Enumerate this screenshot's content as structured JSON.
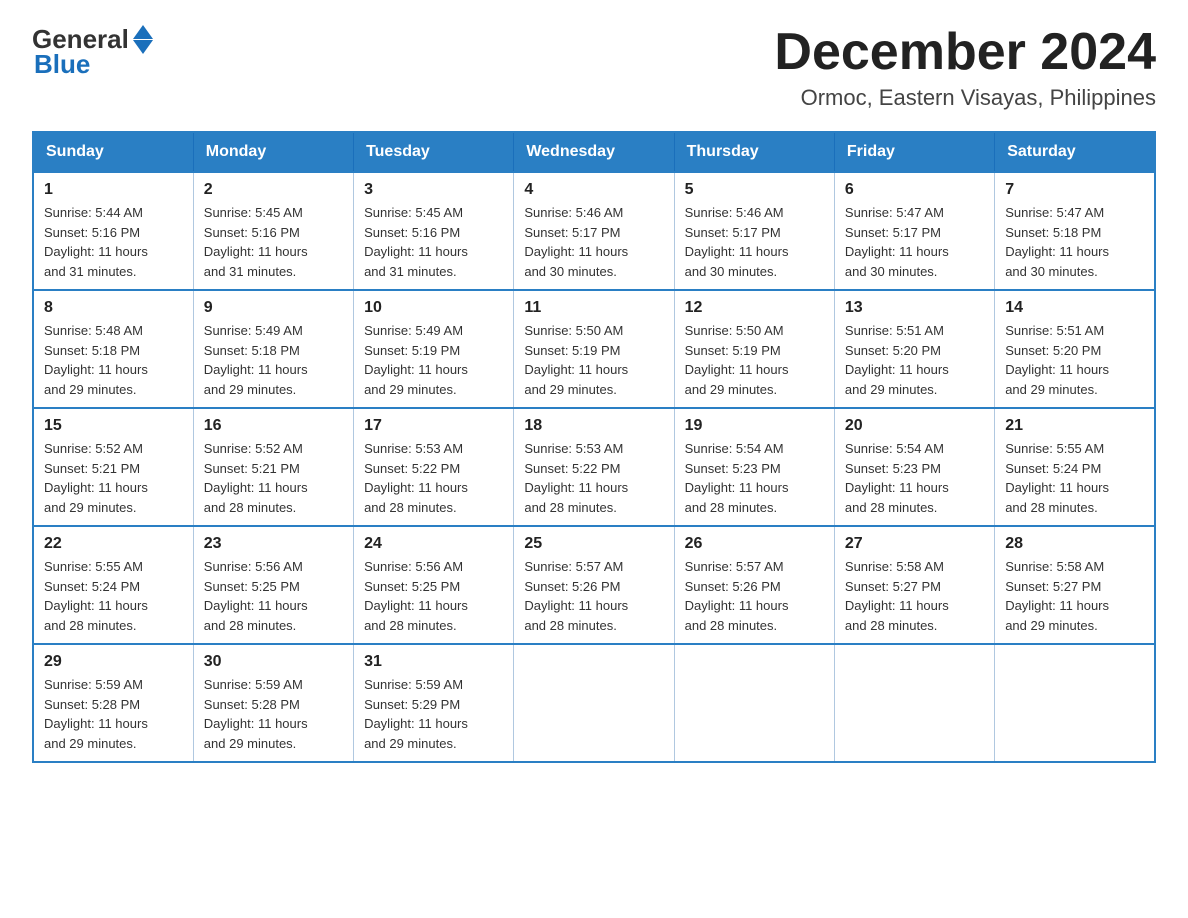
{
  "header": {
    "logo_general": "General",
    "logo_blue": "Blue",
    "month_title": "December 2024",
    "location": "Ormoc, Eastern Visayas, Philippines"
  },
  "weekdays": [
    "Sunday",
    "Monday",
    "Tuesday",
    "Wednesday",
    "Thursday",
    "Friday",
    "Saturday"
  ],
  "weeks": [
    [
      {
        "day": "1",
        "sunrise": "5:44 AM",
        "sunset": "5:16 PM",
        "daylight": "11 hours and 31 minutes."
      },
      {
        "day": "2",
        "sunrise": "5:45 AM",
        "sunset": "5:16 PM",
        "daylight": "11 hours and 31 minutes."
      },
      {
        "day": "3",
        "sunrise": "5:45 AM",
        "sunset": "5:16 PM",
        "daylight": "11 hours and 31 minutes."
      },
      {
        "day": "4",
        "sunrise": "5:46 AM",
        "sunset": "5:17 PM",
        "daylight": "11 hours and 30 minutes."
      },
      {
        "day": "5",
        "sunrise": "5:46 AM",
        "sunset": "5:17 PM",
        "daylight": "11 hours and 30 minutes."
      },
      {
        "day": "6",
        "sunrise": "5:47 AM",
        "sunset": "5:17 PM",
        "daylight": "11 hours and 30 minutes."
      },
      {
        "day": "7",
        "sunrise": "5:47 AM",
        "sunset": "5:18 PM",
        "daylight": "11 hours and 30 minutes."
      }
    ],
    [
      {
        "day": "8",
        "sunrise": "5:48 AM",
        "sunset": "5:18 PM",
        "daylight": "11 hours and 29 minutes."
      },
      {
        "day": "9",
        "sunrise": "5:49 AM",
        "sunset": "5:18 PM",
        "daylight": "11 hours and 29 minutes."
      },
      {
        "day": "10",
        "sunrise": "5:49 AM",
        "sunset": "5:19 PM",
        "daylight": "11 hours and 29 minutes."
      },
      {
        "day": "11",
        "sunrise": "5:50 AM",
        "sunset": "5:19 PM",
        "daylight": "11 hours and 29 minutes."
      },
      {
        "day": "12",
        "sunrise": "5:50 AM",
        "sunset": "5:19 PM",
        "daylight": "11 hours and 29 minutes."
      },
      {
        "day": "13",
        "sunrise": "5:51 AM",
        "sunset": "5:20 PM",
        "daylight": "11 hours and 29 minutes."
      },
      {
        "day": "14",
        "sunrise": "5:51 AM",
        "sunset": "5:20 PM",
        "daylight": "11 hours and 29 minutes."
      }
    ],
    [
      {
        "day": "15",
        "sunrise": "5:52 AM",
        "sunset": "5:21 PM",
        "daylight": "11 hours and 29 minutes."
      },
      {
        "day": "16",
        "sunrise": "5:52 AM",
        "sunset": "5:21 PM",
        "daylight": "11 hours and 28 minutes."
      },
      {
        "day": "17",
        "sunrise": "5:53 AM",
        "sunset": "5:22 PM",
        "daylight": "11 hours and 28 minutes."
      },
      {
        "day": "18",
        "sunrise": "5:53 AM",
        "sunset": "5:22 PM",
        "daylight": "11 hours and 28 minutes."
      },
      {
        "day": "19",
        "sunrise": "5:54 AM",
        "sunset": "5:23 PM",
        "daylight": "11 hours and 28 minutes."
      },
      {
        "day": "20",
        "sunrise": "5:54 AM",
        "sunset": "5:23 PM",
        "daylight": "11 hours and 28 minutes."
      },
      {
        "day": "21",
        "sunrise": "5:55 AM",
        "sunset": "5:24 PM",
        "daylight": "11 hours and 28 minutes."
      }
    ],
    [
      {
        "day": "22",
        "sunrise": "5:55 AM",
        "sunset": "5:24 PM",
        "daylight": "11 hours and 28 minutes."
      },
      {
        "day": "23",
        "sunrise": "5:56 AM",
        "sunset": "5:25 PM",
        "daylight": "11 hours and 28 minutes."
      },
      {
        "day": "24",
        "sunrise": "5:56 AM",
        "sunset": "5:25 PM",
        "daylight": "11 hours and 28 minutes."
      },
      {
        "day": "25",
        "sunrise": "5:57 AM",
        "sunset": "5:26 PM",
        "daylight": "11 hours and 28 minutes."
      },
      {
        "day": "26",
        "sunrise": "5:57 AM",
        "sunset": "5:26 PM",
        "daylight": "11 hours and 28 minutes."
      },
      {
        "day": "27",
        "sunrise": "5:58 AM",
        "sunset": "5:27 PM",
        "daylight": "11 hours and 28 minutes."
      },
      {
        "day": "28",
        "sunrise": "5:58 AM",
        "sunset": "5:27 PM",
        "daylight": "11 hours and 29 minutes."
      }
    ],
    [
      {
        "day": "29",
        "sunrise": "5:59 AM",
        "sunset": "5:28 PM",
        "daylight": "11 hours and 29 minutes."
      },
      {
        "day": "30",
        "sunrise": "5:59 AM",
        "sunset": "5:28 PM",
        "daylight": "11 hours and 29 minutes."
      },
      {
        "day": "31",
        "sunrise": "5:59 AM",
        "sunset": "5:29 PM",
        "daylight": "11 hours and 29 minutes."
      },
      null,
      null,
      null,
      null
    ]
  ],
  "labels": {
    "sunrise": "Sunrise:",
    "sunset": "Sunset:",
    "daylight": "Daylight:"
  }
}
